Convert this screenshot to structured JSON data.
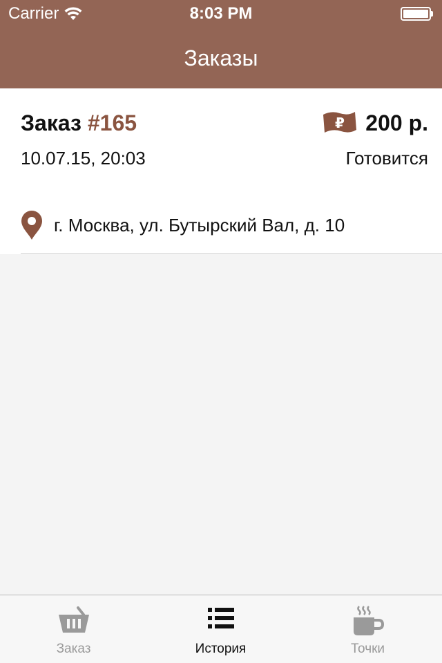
{
  "status_bar": {
    "carrier": "Carrier",
    "time": "8:03 PM",
    "battery_level": 1.0
  },
  "nav": {
    "title": "Заказы"
  },
  "order": {
    "title_prefix": "Заказ",
    "number": "#165",
    "price": "200 р.",
    "datetime": "10.07.15, 20:03",
    "status": "Готовится",
    "address": "г. Москва, ул. Бутырский Вал, д. 10",
    "icons": [
      "ruble-banknote-icon",
      "map-pin-icon"
    ]
  },
  "tabs": [
    {
      "label": "Заказ",
      "icon": "basket-icon",
      "active": false
    },
    {
      "label": "История",
      "icon": "list-icon",
      "active": true
    },
    {
      "label": "Точки",
      "icon": "coffee-cup-icon",
      "active": false
    }
  ],
  "colors": {
    "header_bg": "#936555",
    "accent": "#8a5440",
    "background": "#f4f4f4",
    "tab_inactive": "#9a9a9a"
  }
}
